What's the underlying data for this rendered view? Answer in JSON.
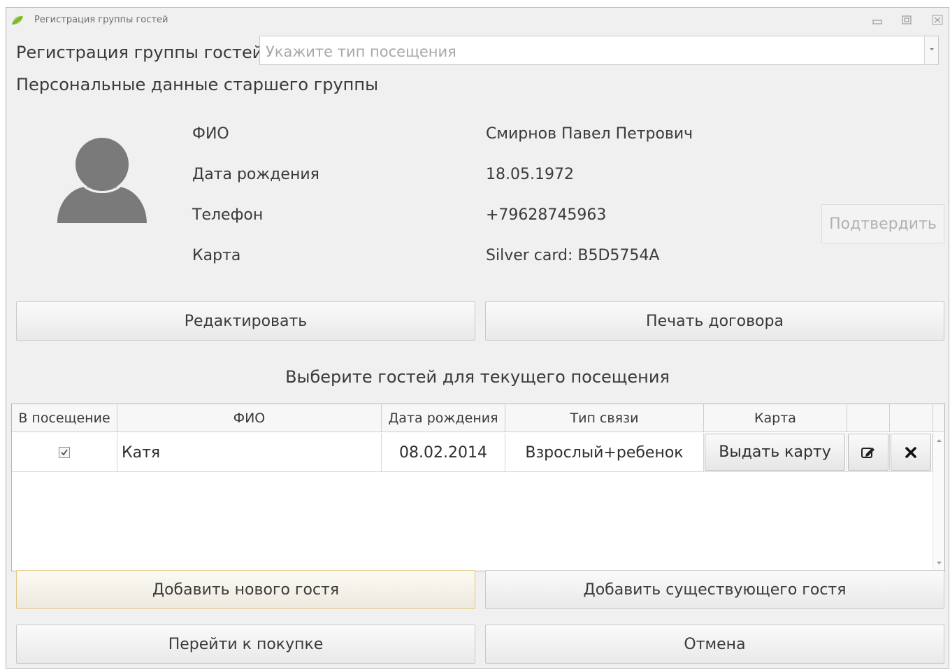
{
  "window": {
    "title": "Регистрация группы гостей",
    "icon": "leaf-icon",
    "controls": [
      "minimize-icon",
      "maximize-icon",
      "close-icon"
    ]
  },
  "header": {
    "title": "Регистрация группы гостей",
    "visit_type_placeholder": "Укажите тип посещения"
  },
  "section_title": "Персональные данные старшего группы",
  "person": {
    "avatar_icon": "user-avatar-icon",
    "fields": [
      {
        "label": "ФИО",
        "value": "Смирнов Павел Петрович"
      },
      {
        "label": "Дата рождения",
        "value": "18.05.1972"
      },
      {
        "label": "Телефон",
        "value": "+79628745963"
      },
      {
        "label": "Карта",
        "value": "Silver card: B5D5754A"
      }
    ],
    "confirm_label": "Подтвердить"
  },
  "actions": {
    "edit_label": "Редактировать",
    "print_label": "Печать договора"
  },
  "guests": {
    "caption": "Выберите гостей для текущего посещения",
    "columns": [
      "В посещение",
      "ФИО",
      "Дата рождения",
      "Тип связи",
      "Карта",
      "",
      ""
    ],
    "rows": [
      {
        "in_visit": true,
        "name": "Катя",
        "birth_date": "08.02.2014",
        "relation": "Взрослый+ребенок",
        "card_button": "Выдать карту",
        "edit_icon": "edit-icon",
        "delete_icon": "delete-icon"
      }
    ]
  },
  "footer": {
    "add_new_label": "Добавить нового гостя",
    "add_existing_label": "Добавить существующего гостя",
    "purchase_label": "Перейти к покупке",
    "cancel_label": "Отмена"
  },
  "colors": {
    "background": "#f0f0f0",
    "focus_border": "#e2c684",
    "avatar": "#7a7a7a",
    "icon_accent": "#8dc63f"
  }
}
